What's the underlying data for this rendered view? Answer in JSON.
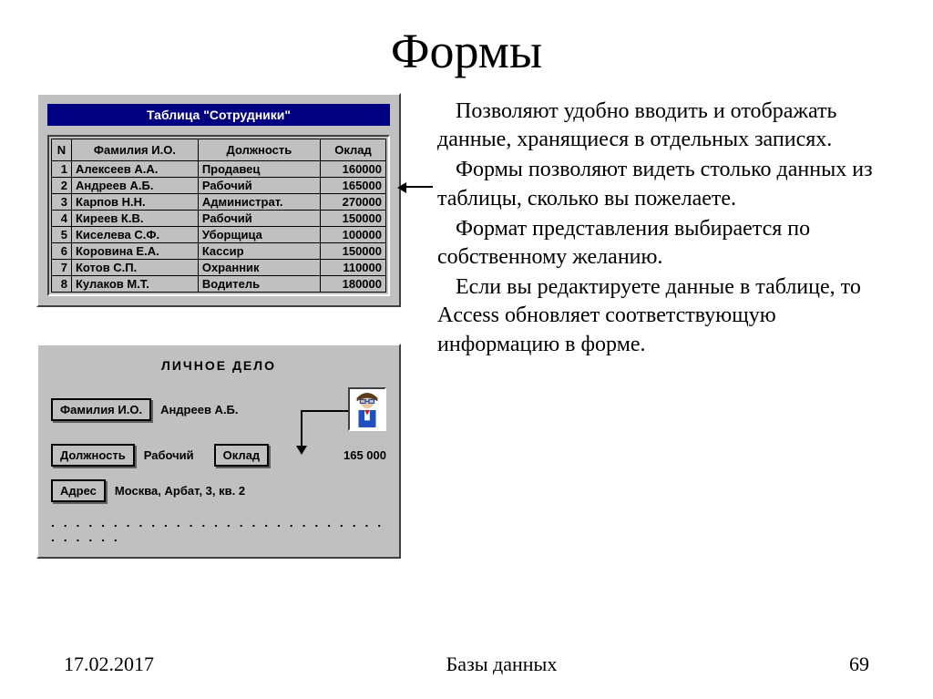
{
  "slide": {
    "title": "Формы",
    "paragraphs": [
      "Позволяют удобно вводить и отображать данные, хранящиеся в отдельных записях.",
      "Формы позволяют видеть столько данных из таблицы, сколько вы пожелаете.",
      "Формат представления выбирается по собственному желанию.",
      "Если вы редактируете данные в таблице, то Access обновляет соответствующую информацию в форме."
    ]
  },
  "tablePanel": {
    "title": "Таблица  \"Сотрудники\"",
    "headers": {
      "n": "N",
      "name": "Фамилия И.О.",
      "job": "Должность",
      "salary": "Оклад"
    },
    "rows": [
      {
        "n": "1",
        "name": "Алексеев А.А.",
        "job": "Продавец",
        "salary": "160000"
      },
      {
        "n": "2",
        "name": "Андреев А.Б.",
        "job": "Рабочий",
        "salary": "165000"
      },
      {
        "n": "3",
        "name": "Карпов Н.Н.",
        "job": "Администрат.",
        "salary": "270000"
      },
      {
        "n": "4",
        "name": "Киреев К.В.",
        "job": "Рабочий",
        "salary": "150000"
      },
      {
        "n": "5",
        "name": "Киселева С.Ф.",
        "job": "Уборщица",
        "salary": "100000"
      },
      {
        "n": "6",
        "name": "Коровина Е.А.",
        "job": "Кассир",
        "salary": "150000"
      },
      {
        "n": "7",
        "name": "Котов С.П.",
        "job": "Охранник",
        "salary": "110000"
      },
      {
        "n": "8",
        "name": "Кулаков М.Т.",
        "job": "Водитель",
        "salary": "180000"
      }
    ]
  },
  "formPanel": {
    "title": "ЛИЧНОЕ  ДЕЛО",
    "labels": {
      "name": "Фамилия И.О.",
      "job": "Должность",
      "salary": "Оклад",
      "address": "Адрес"
    },
    "values": {
      "name": "Андреев А.Б.",
      "job": "Рабочий",
      "salary": "165 000",
      "address": "Москва, Арбат, 3, кв. 2"
    },
    "dots": ". . . . . . . . . . . . . . . . . . . . . . . . . . . . . . . . ."
  },
  "footer": {
    "date": "17.02.2017",
    "subject": "Базы данных",
    "page": "69"
  }
}
